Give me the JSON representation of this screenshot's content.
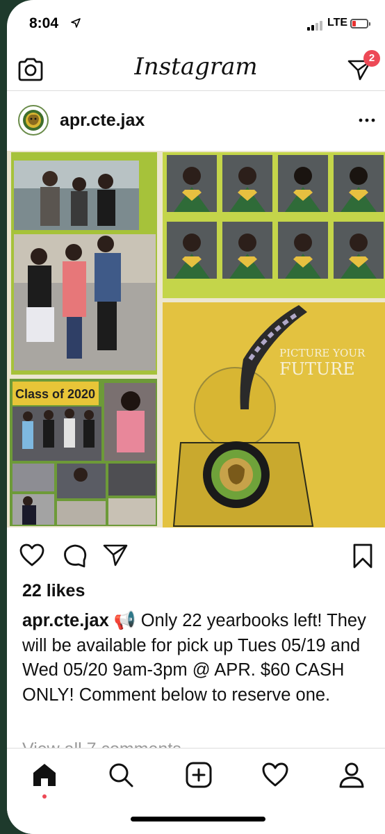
{
  "status_bar": {
    "time": "8:04",
    "network": "LTE",
    "battery_color": "#e8312f"
  },
  "header": {
    "title": "Instagram",
    "camera_icon": "camera-icon",
    "direct_icon": "direct-message-icon",
    "direct_badge": "2"
  },
  "post": {
    "username": "apr.cte.jax",
    "more_icon": "more-horizontal-icon",
    "image": {
      "description_icons": "yearbook-collage",
      "class_banner": "Class of 2020",
      "cover_text_line1": "PICTURE YOUR",
      "cover_text_line2": "FUTURE"
    },
    "actions": {
      "like_icon": "heart-icon",
      "comment_icon": "comment-icon",
      "share_icon": "paper-plane-icon",
      "save_icon": "bookmark-icon"
    },
    "likes": "22 likes",
    "caption_user": "apr.cte.jax",
    "caption_emoji": "📢",
    "caption_text": "Only 22 yearbooks left! They will be available for pick up Tues 05/19 and Wed 05/20 9am-3pm @ APR. $60 CASH ONLY! Comment below to reserve one.",
    "view_comments": "View all 7 comments"
  },
  "tab_bar": {
    "items": [
      "home-icon",
      "search-icon",
      "new-post-icon",
      "activity-heart-icon",
      "profile-icon"
    ],
    "active": "home-icon",
    "accent": "#ed4956"
  }
}
